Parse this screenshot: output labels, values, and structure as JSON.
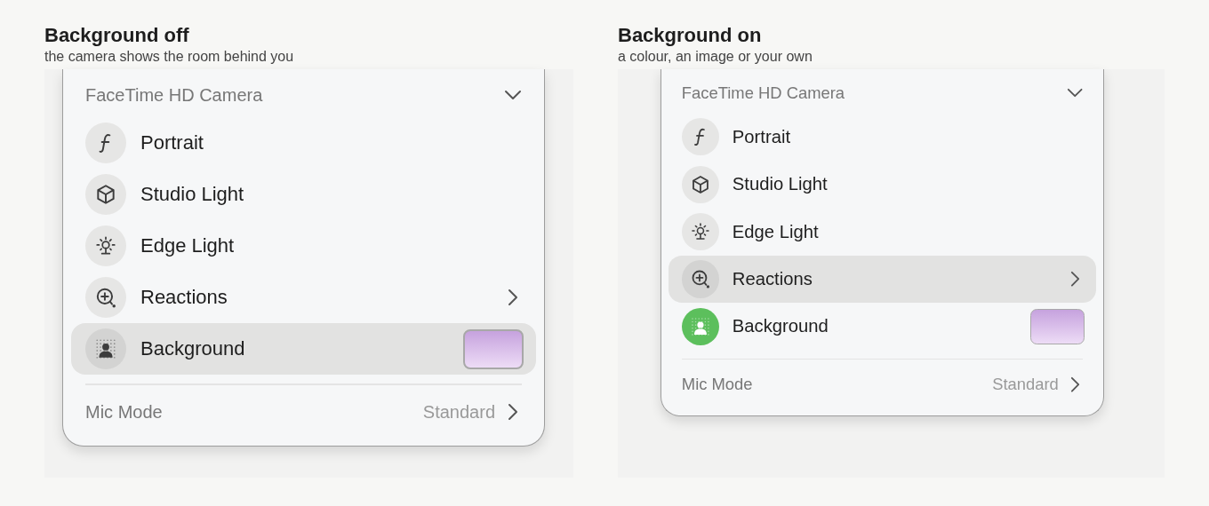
{
  "panels": [
    {
      "title": "Background off",
      "subtitle": "the camera shows the room behind you",
      "menu": {
        "camera": "FaceTime HD Camera",
        "items": [
          {
            "label": "Portrait",
            "kind": "plain",
            "highlighted": false,
            "on": false
          },
          {
            "label": "Studio Light",
            "kind": "plain",
            "highlighted": false,
            "on": false
          },
          {
            "label": "Edge Light",
            "kind": "plain",
            "highlighted": false,
            "on": false
          },
          {
            "label": "Reactions",
            "kind": "submenu",
            "highlighted": false,
            "on": false
          },
          {
            "label": "Background",
            "kind": "swatch",
            "highlighted": true,
            "on": false
          }
        ],
        "mic": {
          "label": "Mic Mode",
          "value": "Standard"
        }
      }
    },
    {
      "title": "Background on",
      "subtitle": "a colour, an image or your own",
      "menu": {
        "camera": "FaceTime HD Camera",
        "items": [
          {
            "label": "Portrait",
            "kind": "plain",
            "highlighted": false,
            "on": false
          },
          {
            "label": "Studio Light",
            "kind": "plain",
            "highlighted": false,
            "on": false
          },
          {
            "label": "Edge Light",
            "kind": "plain",
            "highlighted": false,
            "on": false
          },
          {
            "label": "Reactions",
            "kind": "submenu",
            "highlighted": true,
            "on": false
          },
          {
            "label": "Background",
            "kind": "swatch",
            "highlighted": false,
            "on": true
          }
        ],
        "mic": {
          "label": "Mic Mode",
          "value": "Standard"
        }
      }
    }
  ]
}
